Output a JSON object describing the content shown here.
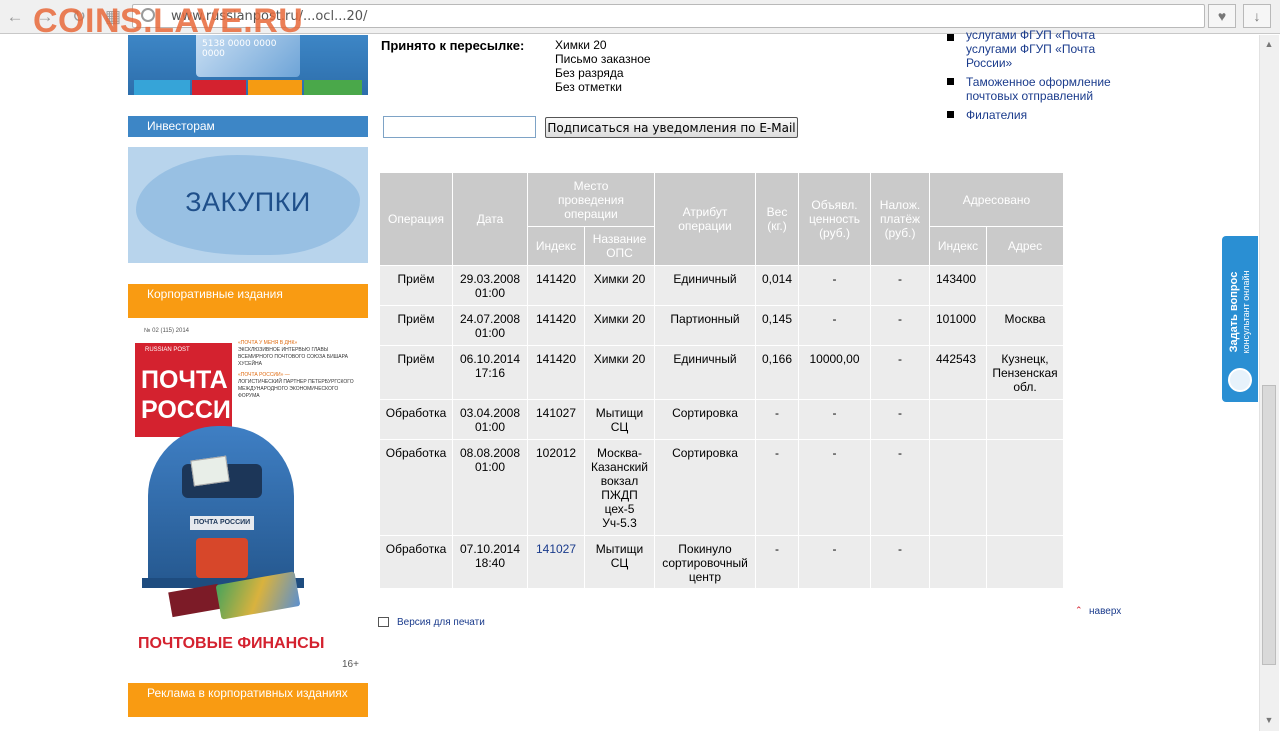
{
  "browser": {
    "url": "www.russianpost.ru/...ocl...20/",
    "watermark": "COINS.LAVE.RU"
  },
  "sidebar": {
    "card_number": "5138 0000 0000 0000",
    "investors": "Инвесторам",
    "zakupki": "ЗАКУПКИ",
    "corporate": "Корпоративные издания",
    "magazine": {
      "issue": "№ 02 (115) 2014",
      "brand_small": "RUSSIAN POST",
      "logo_line1": "ПОЧТА",
      "logo_line2": "РОССИИ",
      "blurb1": "«ПОЧТА У МЕНЯ В ДНК»",
      "blurb2": "ЭКСКЛЮЗИВНОЕ ИНТЕРВЬЮ ГЛАВЫ ВСЕМИРНОГО ПОЧТОВОГО СОЮЗА БИШАРА ХУСЕЙНА",
      "blurb3": "«ПОЧТА РОССИИ» —",
      "blurb4": "ЛОГИСТИЧЕСКИЙ ПАРТНЕР ПЕТЕРБУРГСКОГО МЕЖДУНАРОДНОГО ЭКОНОМИЧЕСКОГО ФОРУМА",
      "mailbox_plate": "ПОЧТА РОССИИ",
      "finance": "ПОЧТОВЫЕ ФИНАНСЫ",
      "age": "16+"
    },
    "ads": "Реклама в корпоративных изданиях"
  },
  "accepted": {
    "label": "Принято к пересылке:",
    "lines": [
      "Химки 20",
      "Письмо заказное",
      "Без разряда",
      "Без отметки"
    ]
  },
  "subscribe": {
    "input_value": "",
    "button": "Подписаться на уведомления по E-Mail"
  },
  "right_links": [
    "Обращения пользователей услугами ФГУП «Почта России»",
    "Таможенное оформление почтовых отправлений",
    "Филателия"
  ],
  "table": {
    "headers": {
      "operation": "Операция",
      "date": "Дата",
      "place": "Место проведения операции",
      "index": "Индекс",
      "ops_name": "Название ОПС",
      "attribute": "Атрибут операции",
      "weight": "Вес (кг.)",
      "declared": "Объявл. ценность (руб.)",
      "cod": "Налож. платёж (руб.)",
      "addressed": "Адресовано",
      "addr_index": "Индекс",
      "addr": "Адрес"
    },
    "rows": [
      {
        "op": "Приём",
        "date": "29.03.2008 01:00",
        "index": "141420",
        "name": "Химки 20",
        "attr": "Единичный",
        "weight": "0,014",
        "declared": "-",
        "cod": "-",
        "to_index": "143400",
        "to_addr": ""
      },
      {
        "op": "Приём",
        "date": "24.07.2008 01:00",
        "index": "141420",
        "name": "Химки 20",
        "attr": "Партионный",
        "weight": "0,145",
        "declared": "-",
        "cod": "-",
        "to_index": "101000",
        "to_addr": "Москва"
      },
      {
        "op": "Приём",
        "date": "06.10.2014 17:16",
        "index": "141420",
        "name": "Химки 20",
        "attr": "Единичный",
        "weight": "0,166",
        "declared": "10000,00",
        "cod": "-",
        "to_index": "442543",
        "to_addr": "Кузнецк, Пензенская обл."
      },
      {
        "op": "Обработка",
        "date": "03.04.2008 01:00",
        "index": "141027",
        "name": "Мытищи СЦ",
        "attr": "Сортировка",
        "weight": "-",
        "declared": "-",
        "cod": "-",
        "to_index": "",
        "to_addr": ""
      },
      {
        "op": "Обработка",
        "date": "08.08.2008 01:00",
        "index": "102012",
        "name": "Москва-Казанский вокзал ПЖДП цех-5 Уч-5.3",
        "attr": "Сортировка",
        "weight": "-",
        "declared": "-",
        "cod": "-",
        "to_index": "",
        "to_addr": ""
      },
      {
        "op": "Обработка",
        "date": "07.10.2014 18:40",
        "index": "141027",
        "name": "Мытищи СЦ",
        "attr": "Покинуло сортировочный центр",
        "weight": "-",
        "declared": "-",
        "cod": "-",
        "to_index": "",
        "to_addr": ""
      }
    ]
  },
  "footer": {
    "print": "Версия для печати",
    "top": "наверх"
  },
  "consultant": {
    "text_line1": "Задать вопрос",
    "text_line2": "консультант онлайн"
  },
  "colors": {
    "blue_header": "#3d86c6",
    "orange_header": "#f99b12",
    "table_header": "#cacaca",
    "table_cell": "#ececec",
    "link": "#1a3b8c",
    "consultant": "#2a8fd3"
  }
}
